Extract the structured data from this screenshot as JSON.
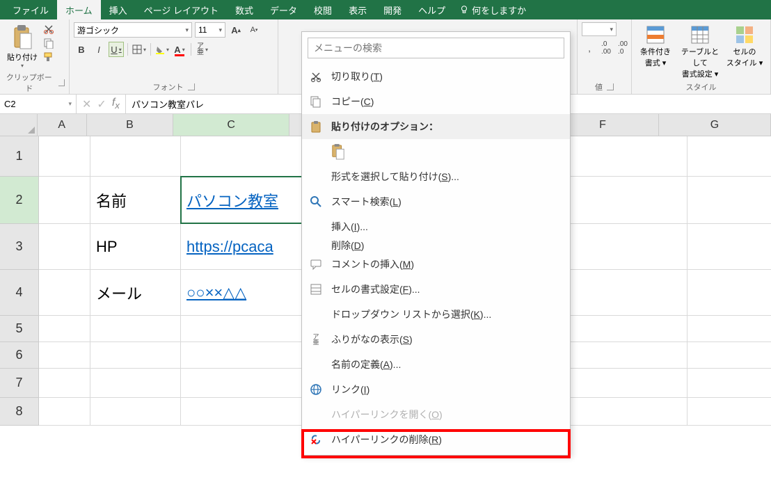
{
  "tabs": {
    "file": "ファイル",
    "home": "ホーム",
    "insert": "挿入",
    "page_layout": "ページ レイアウト",
    "formulas": "数式",
    "data": "データ",
    "review": "校閲",
    "view": "表示",
    "developer": "開発",
    "help": "ヘルプ",
    "tell_me": "何をしますか"
  },
  "ribbon": {
    "clipboard": {
      "paste": "貼り付け",
      "group": "クリップボード"
    },
    "font": {
      "name": "游ゴシック",
      "size": "11",
      "group": "フォント"
    },
    "number": {
      "group": "値"
    },
    "styles": {
      "conditional": "条件付き\n書式 ▾",
      "table": "テーブルとして\n書式設定 ▾",
      "cell": "セルの\nスタイル ▾",
      "group": "スタイル"
    }
  },
  "name_box": "C2",
  "formula": "パソコン教室パレ",
  "columns": [
    "A",
    "B",
    "C",
    "F",
    "G"
  ],
  "rows": [
    "1",
    "2",
    "3",
    "4",
    "5",
    "6",
    "7",
    "8"
  ],
  "cells": {
    "b2": "名前",
    "c2": "パソコン教室",
    "b3": "HP",
    "c3": "https://pcaca",
    "b4": "メール",
    "c4": "○○××△△"
  },
  "context_menu": {
    "search_placeholder": "メニューの検索",
    "cut": "切り取り",
    "cut_key": "T",
    "copy": "コピー",
    "copy_key": "C",
    "paste_options": "貼り付けのオプション：",
    "paste_special": "形式を選択して貼り付け",
    "paste_special_key": "S",
    "smart_lookup": "スマート検索",
    "smart_lookup_key": "L",
    "insert": "挿入",
    "insert_key": "I",
    "delete": "削除",
    "delete_key": "D",
    "insert_comment": "コメントの挿入",
    "insert_comment_key": "M",
    "format_cells": "セルの書式設定",
    "format_cells_key": "F",
    "dropdown_pick": "ドロップダウン リストから選択",
    "dropdown_pick_key": "K",
    "show_phonetic": "ふりがなの表示",
    "show_phonetic_key": "S",
    "define_name": "名前の定義",
    "define_name_key": "A",
    "link": "リンク",
    "link_key": "I",
    "open_hyperlink": "ハイパーリンクを開く",
    "open_hyperlink_key": "O",
    "remove_hyperlink": "ハイパーリンクの削除",
    "remove_hyperlink_key": "R"
  }
}
